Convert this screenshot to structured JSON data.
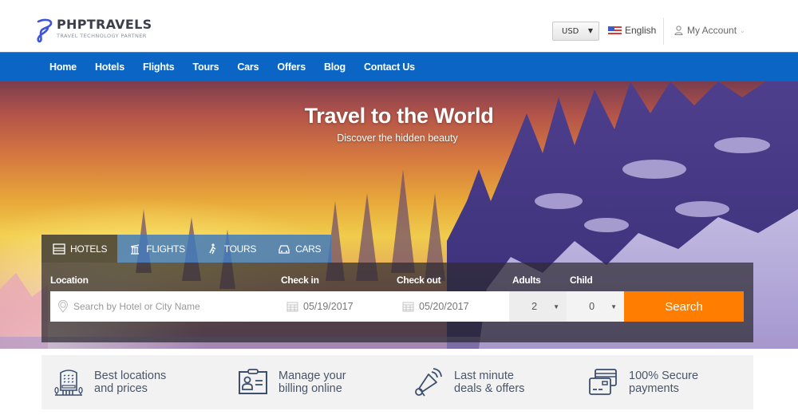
{
  "header": {
    "brand_name": "PHPTRAVELS",
    "brand_tagline": "TRAVEL TECHNOLOGY PARTNER",
    "currency": "USD",
    "language": "English",
    "account": "My Account"
  },
  "nav": {
    "items": [
      "Home",
      "Hotels",
      "Flights",
      "Tours",
      "Cars",
      "Offers",
      "Blog",
      "Contact Us"
    ]
  },
  "hero": {
    "title": "Travel to the World",
    "subtitle": "Discover the hidden beauty"
  },
  "search": {
    "tabs": [
      {
        "label": "HOTELS",
        "icon": "hotel-icon",
        "active": true
      },
      {
        "label": "FLIGHTS",
        "icon": "flight-icon",
        "active": false
      },
      {
        "label": "TOURS",
        "icon": "tour-icon",
        "active": false
      },
      {
        "label": "CARS",
        "icon": "car-icon",
        "active": false
      }
    ],
    "labels": {
      "location": "Location",
      "checkin": "Check in",
      "checkout": "Check out",
      "adults": "Adults",
      "child": "Child"
    },
    "location_placeholder": "Search by Hotel or City Name",
    "checkin_value": "05/19/2017",
    "checkout_value": "05/20/2017",
    "adults_value": "2",
    "child_value": "0",
    "button_label": "Search",
    "button_color": "#ff7d00"
  },
  "features": [
    {
      "line1": "Best locations",
      "line2": "and prices",
      "icon": "building-icon"
    },
    {
      "line1": "Manage your",
      "line2": "billing online",
      "icon": "id-card-icon"
    },
    {
      "line1": "Last minute",
      "line2": "deals & offers",
      "icon": "megaphone-icon"
    },
    {
      "line1": "100% Secure",
      "line2": "payments",
      "icon": "credit-card-icon"
    }
  ],
  "colors": {
    "nav_blue": "#0a65c4",
    "accent_orange": "#ff7d00"
  }
}
